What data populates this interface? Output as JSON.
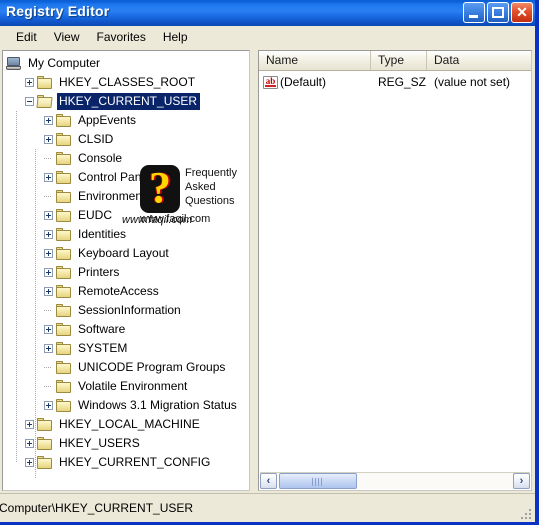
{
  "window": {
    "title": "Registry Editor",
    "caption_buttons": [
      {
        "name": "minimize",
        "label": "–"
      },
      {
        "name": "maximize",
        "label": "□"
      },
      {
        "name": "close",
        "label": "✕"
      }
    ]
  },
  "menubar": {
    "items": [
      {
        "label": "Edit"
      },
      {
        "label": "View"
      },
      {
        "label": "Favorites"
      },
      {
        "label": "Help"
      }
    ]
  },
  "tree": {
    "items": [
      {
        "label": "My Computer",
        "depth": 0,
        "icon": "computer",
        "toggle": "none",
        "selected": false
      },
      {
        "label": "HKEY_CLASSES_ROOT",
        "depth": 1,
        "icon": "folder",
        "toggle": "plus",
        "selected": false
      },
      {
        "label": "HKEY_CURRENT_USER",
        "depth": 1,
        "icon": "folder-open",
        "toggle": "minus",
        "selected": true
      },
      {
        "label": "AppEvents",
        "depth": 2,
        "icon": "folder",
        "toggle": "plus",
        "selected": false
      },
      {
        "label": "CLSID",
        "depth": 2,
        "icon": "folder",
        "toggle": "plus",
        "selected": false
      },
      {
        "label": "Console",
        "depth": 2,
        "icon": "folder",
        "toggle": "none",
        "selected": false
      },
      {
        "label": "Control Panel",
        "depth": 2,
        "icon": "folder",
        "toggle": "plus",
        "selected": false
      },
      {
        "label": "Environment",
        "depth": 2,
        "icon": "folder",
        "toggle": "none",
        "selected": false
      },
      {
        "label": "EUDC",
        "depth": 2,
        "icon": "folder",
        "toggle": "plus",
        "selected": false
      },
      {
        "label": "Identities",
        "depth": 2,
        "icon": "folder",
        "toggle": "plus",
        "selected": false
      },
      {
        "label": "Keyboard Layout",
        "depth": 2,
        "icon": "folder",
        "toggle": "plus",
        "selected": false
      },
      {
        "label": "Printers",
        "depth": 2,
        "icon": "folder",
        "toggle": "plus",
        "selected": false
      },
      {
        "label": "RemoteAccess",
        "depth": 2,
        "icon": "folder",
        "toggle": "plus",
        "selected": false
      },
      {
        "label": "SessionInformation",
        "depth": 2,
        "icon": "folder",
        "toggle": "none",
        "selected": false
      },
      {
        "label": "Software",
        "depth": 2,
        "icon": "folder",
        "toggle": "plus",
        "selected": false
      },
      {
        "label": "SYSTEM",
        "depth": 2,
        "icon": "folder",
        "toggle": "plus",
        "selected": false
      },
      {
        "label": "UNICODE Program Groups",
        "depth": 2,
        "icon": "folder",
        "toggle": "none",
        "selected": false
      },
      {
        "label": "Volatile Environment",
        "depth": 2,
        "icon": "folder",
        "toggle": "none",
        "selected": false
      },
      {
        "label": "Windows 3.1 Migration Status",
        "depth": 2,
        "icon": "folder",
        "toggle": "plus",
        "selected": false
      },
      {
        "label": "HKEY_LOCAL_MACHINE",
        "depth": 1,
        "icon": "folder",
        "toggle": "plus",
        "selected": false
      },
      {
        "label": "HKEY_USERS",
        "depth": 1,
        "icon": "folder",
        "toggle": "plus",
        "selected": false
      },
      {
        "label": "HKEY_CURRENT_CONFIG",
        "depth": 1,
        "icon": "folder",
        "toggle": "plus",
        "selected": false
      }
    ]
  },
  "list": {
    "columns": [
      "Name",
      "Type",
      "Data"
    ],
    "rows": [
      {
        "name": "(Default)",
        "type": "REG_SZ",
        "data": "(value not set)",
        "icon": "string-value-icon"
      }
    ]
  },
  "scrollbar": {
    "left_arrow": "‹",
    "right_arrow": "›"
  },
  "statusbar": {
    "path": "Computer\\HKEY_CURRENT_USER"
  },
  "watermark": {
    "line1": "Frequently",
    "line2": "Asked",
    "line3": "Questions",
    "question_mark": "?",
    "url": "www.faqil.com",
    "url2": "www.faqil.com"
  },
  "colors": {
    "titlebar_blue": "#1f78ee",
    "window_border": "#0a33c4",
    "selection_blue": "#0a246a",
    "face": "#ece9d8"
  }
}
